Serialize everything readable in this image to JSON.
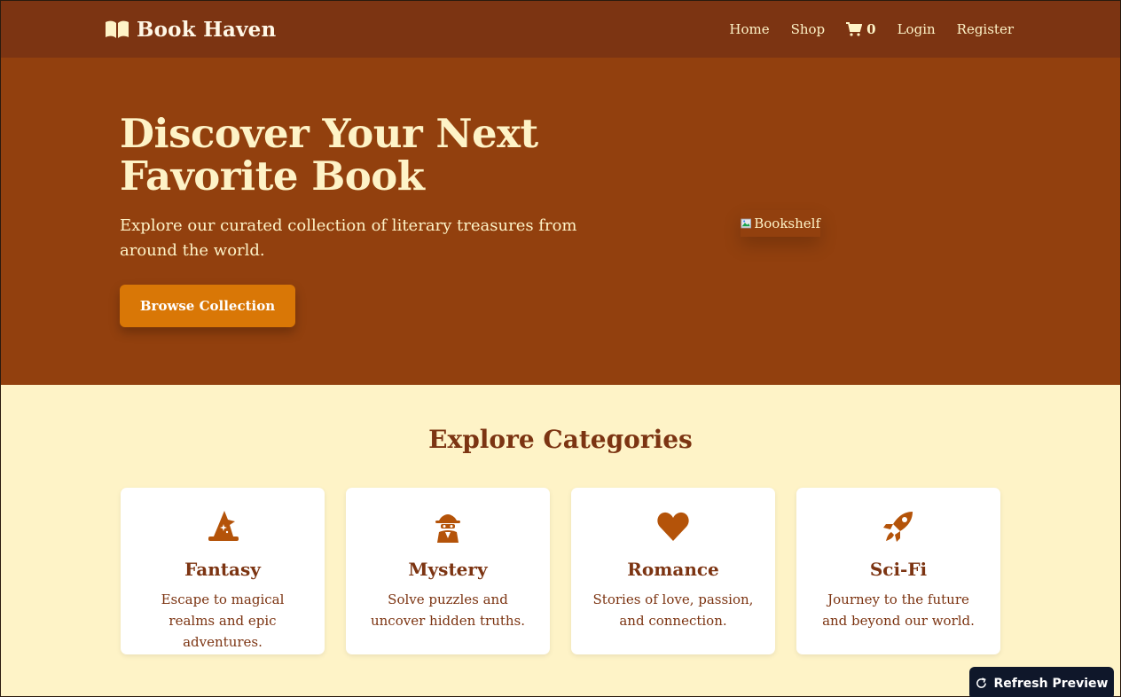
{
  "nav": {
    "brand": "Book Haven",
    "brand_icon": "open-book-icon",
    "links": {
      "home": "Home",
      "shop": "Shop",
      "cart_count": "0",
      "login": "Login",
      "register": "Register"
    }
  },
  "hero": {
    "title": "Discover Your Next Favorite Book",
    "subtitle": "Explore our curated collection of literary treasures from around the world.",
    "cta": "Browse Collection",
    "image_alt": "Bookshelf"
  },
  "categories": {
    "title": "Explore Categories",
    "items": [
      {
        "name": "Fantasy",
        "desc": "Escape to magical realms and epic adventures.",
        "icon": "wizard-hat-icon"
      },
      {
        "name": "Mystery",
        "desc": "Solve puzzles and uncover hidden truths.",
        "icon": "detective-icon"
      },
      {
        "name": "Romance",
        "desc": "Stories of love, passion, and connection.",
        "icon": "heart-icon"
      },
      {
        "name": "Sci-Fi",
        "desc": "Journey to the future and beyond our world.",
        "icon": "rocket-icon"
      }
    ]
  },
  "refresh": {
    "label": "Refresh Preview"
  },
  "colors": {
    "nav_bg": "#7c3412",
    "hero_bg": "#92400e",
    "page_bg": "#fef3c7",
    "accent": "#d97706",
    "icon": "#b45309"
  }
}
